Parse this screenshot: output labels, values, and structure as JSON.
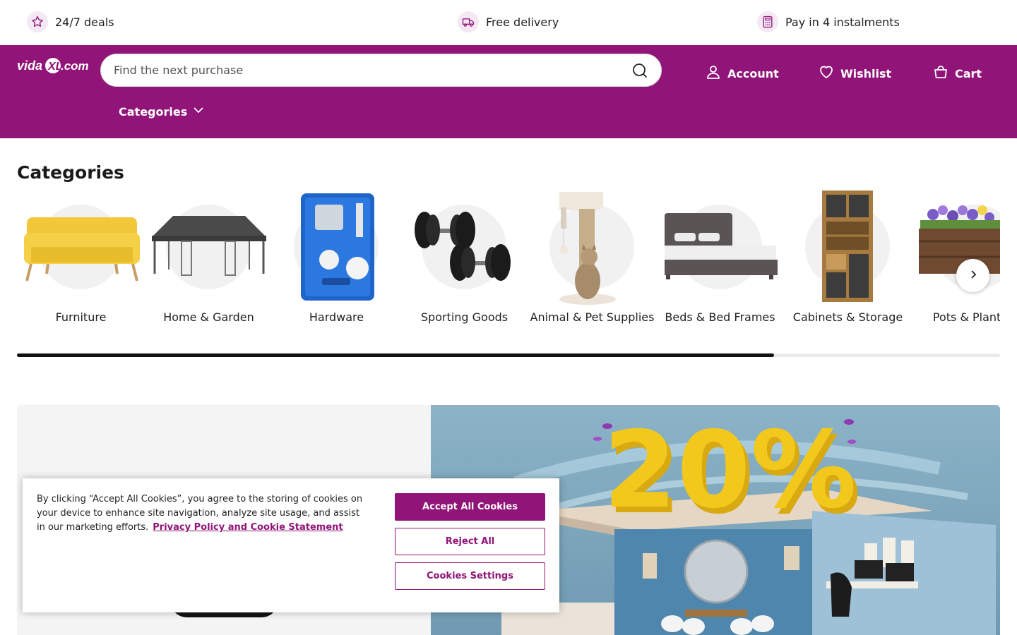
{
  "promo": [
    {
      "icon": "star-icon",
      "label": "24/7 deals"
    },
    {
      "icon": "delivery-truck-icon",
      "label": "Free delivery"
    },
    {
      "icon": "calculator-icon",
      "label": "Pay in 4 instalments"
    }
  ],
  "header": {
    "logo_text": "vidaXL.com",
    "search_placeholder": "Find the next purchase",
    "account_label": "Account",
    "wishlist_label": "Wishlist",
    "cart_label": "Cart",
    "categories_menu_label": "Categories"
  },
  "categories": {
    "title": "Categories",
    "items": [
      {
        "label": "Furniture",
        "icon": "sofa-image"
      },
      {
        "label": "Home & Garden",
        "icon": "gazebo-image"
      },
      {
        "label": "Hardware",
        "icon": "spray-gun-kit-image"
      },
      {
        "label": "Sporting Goods",
        "icon": "dumbbells-image"
      },
      {
        "label": "Animal & Pet Supplies",
        "icon": "cat-tree-image"
      },
      {
        "label": "Beds & Bed Frames",
        "icon": "bed-image"
      },
      {
        "label": "Cabinets & Storage",
        "icon": "cabinet-image"
      },
      {
        "label": "Pots & Planters",
        "icon": "planter-image"
      }
    ],
    "scroll_progress": 0.77
  },
  "banner": {
    "headline": "20%"
  },
  "cookie": {
    "text": "By clicking “Accept All Cookies”, you agree to the storing of cookies on your device to enhance site navigation, analyze site usage, and assist in our marketing efforts.",
    "link": "Privacy Policy and Cookie Statement",
    "accept_label": "Accept All Cookies",
    "reject_label": "Reject All",
    "settings_label": "Cookies Settings"
  },
  "colors": {
    "brand": "#911478",
    "banner_yellow": "#f2c81c"
  }
}
